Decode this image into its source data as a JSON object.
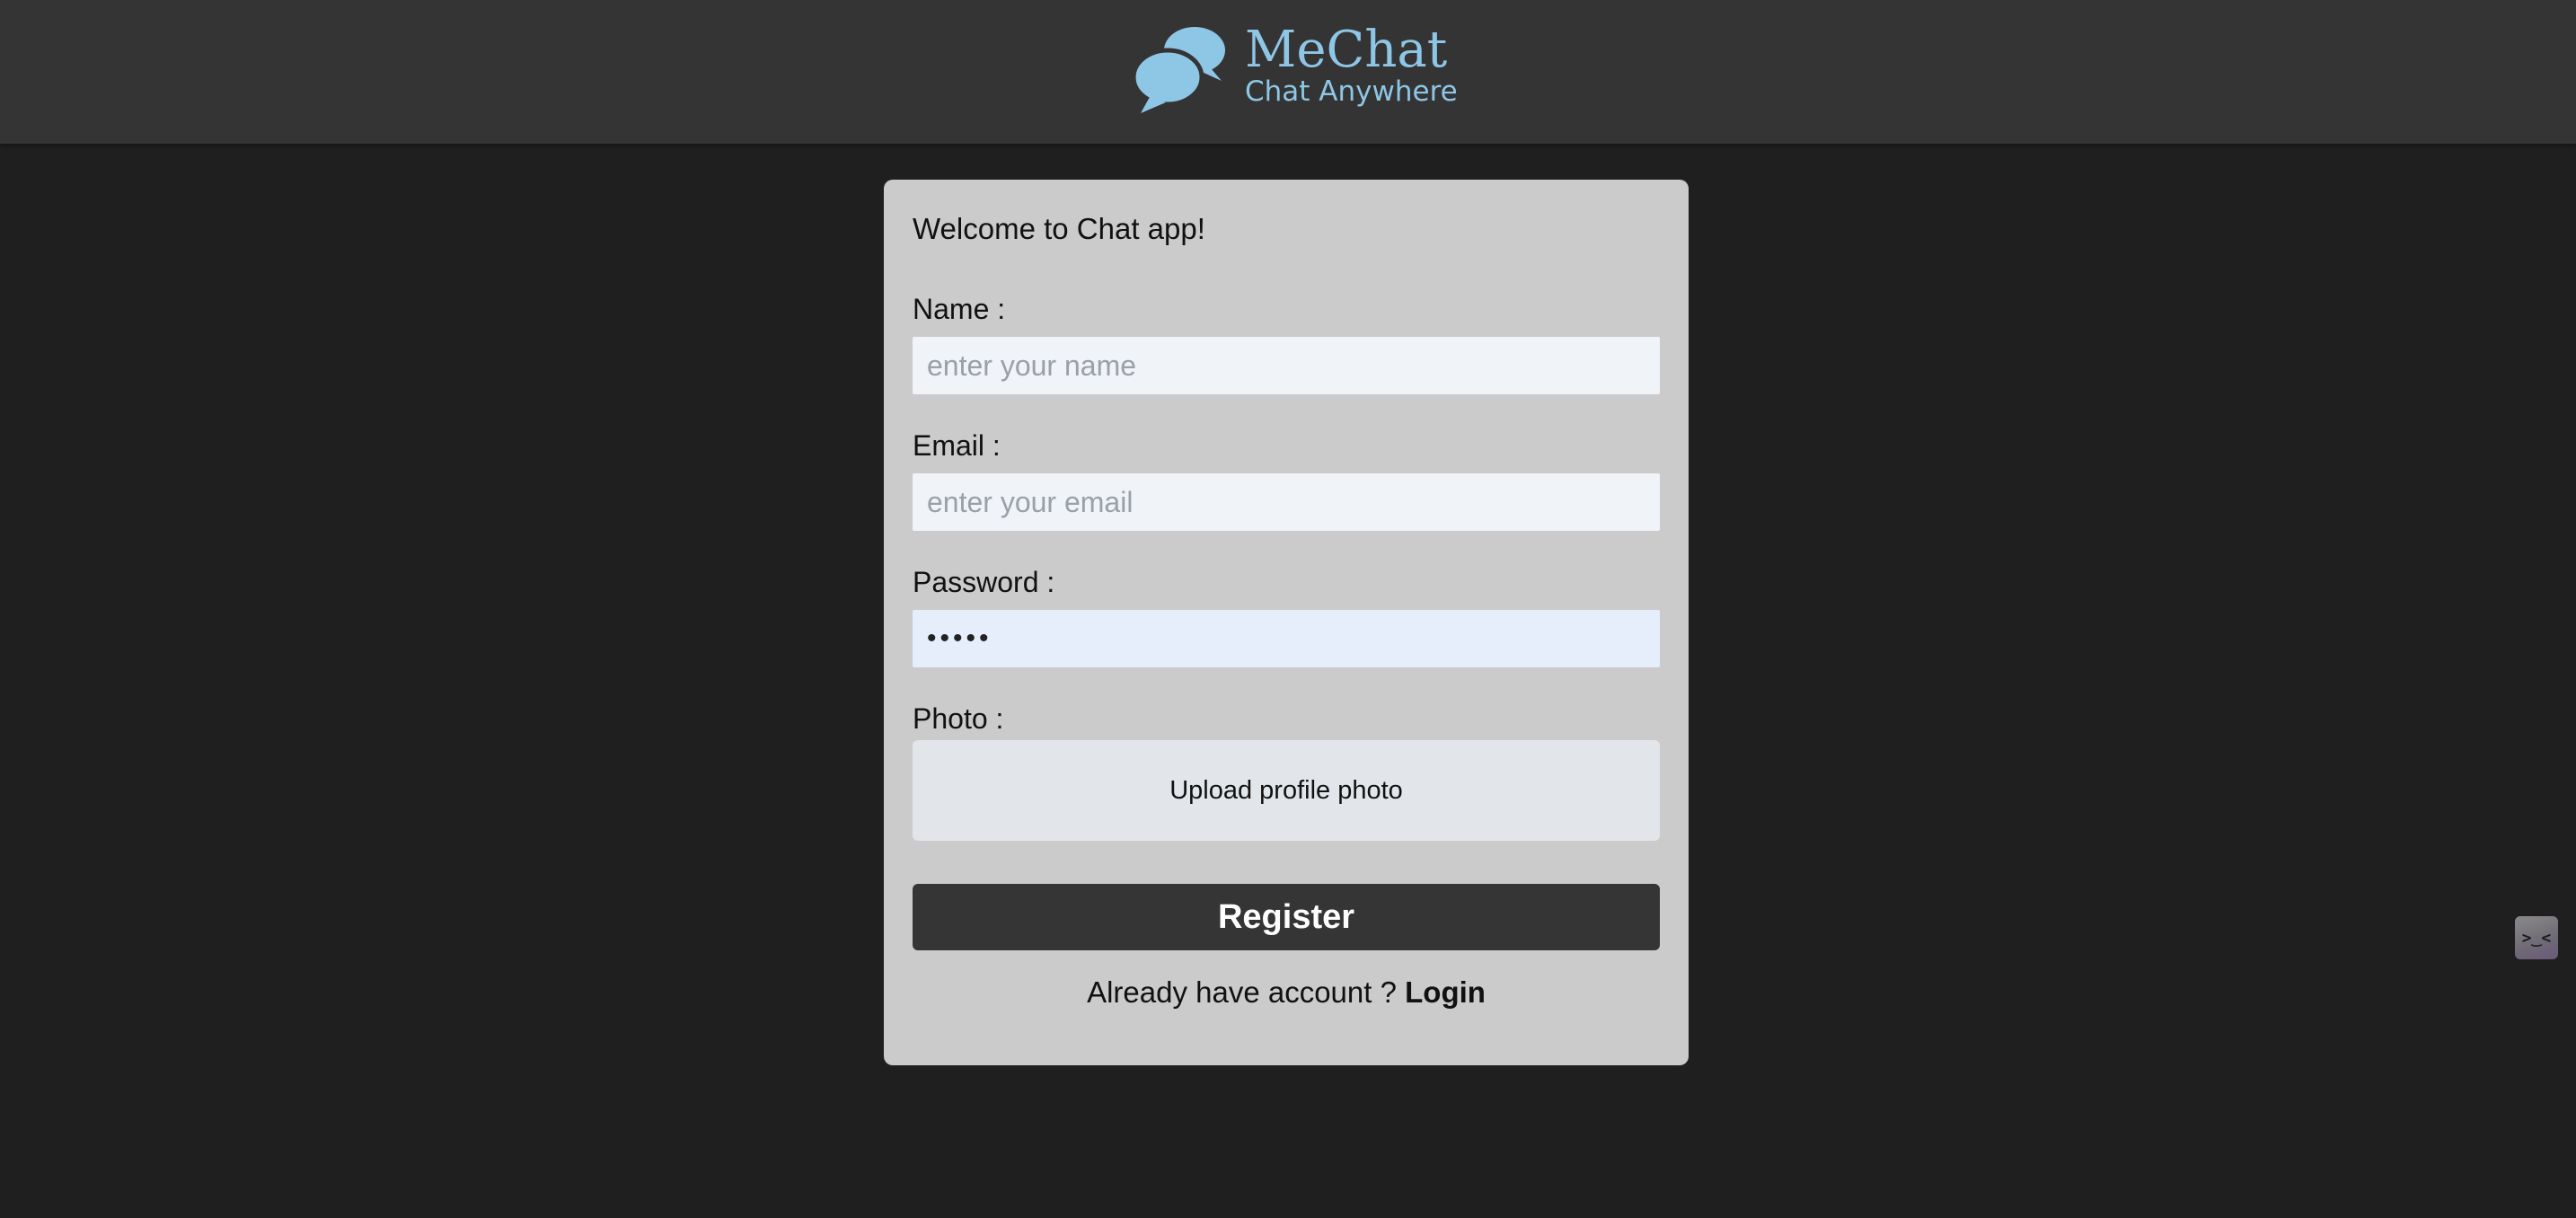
{
  "header": {
    "app_name": "MeChat",
    "tagline": "Chat Anywhere",
    "logo_icon": "chat-bubbles-icon",
    "accent_color": "#8ec6e6"
  },
  "form": {
    "welcome": "Welcome to Chat app!",
    "name": {
      "label": "Name :",
      "placeholder": "enter your name",
      "value": ""
    },
    "email": {
      "label": "Email :",
      "placeholder": "enter your email",
      "value": ""
    },
    "password": {
      "label": "Password :",
      "placeholder": "",
      "value": "•••••"
    },
    "photo": {
      "label": "Photo :",
      "upload_text": "Upload profile photo"
    },
    "register_label": "Register",
    "login_prompt": "Already have account ? ",
    "login_link": "Login"
  },
  "extension": {
    "icon": "terminal-face-icon",
    "glyph": ">‿<"
  }
}
